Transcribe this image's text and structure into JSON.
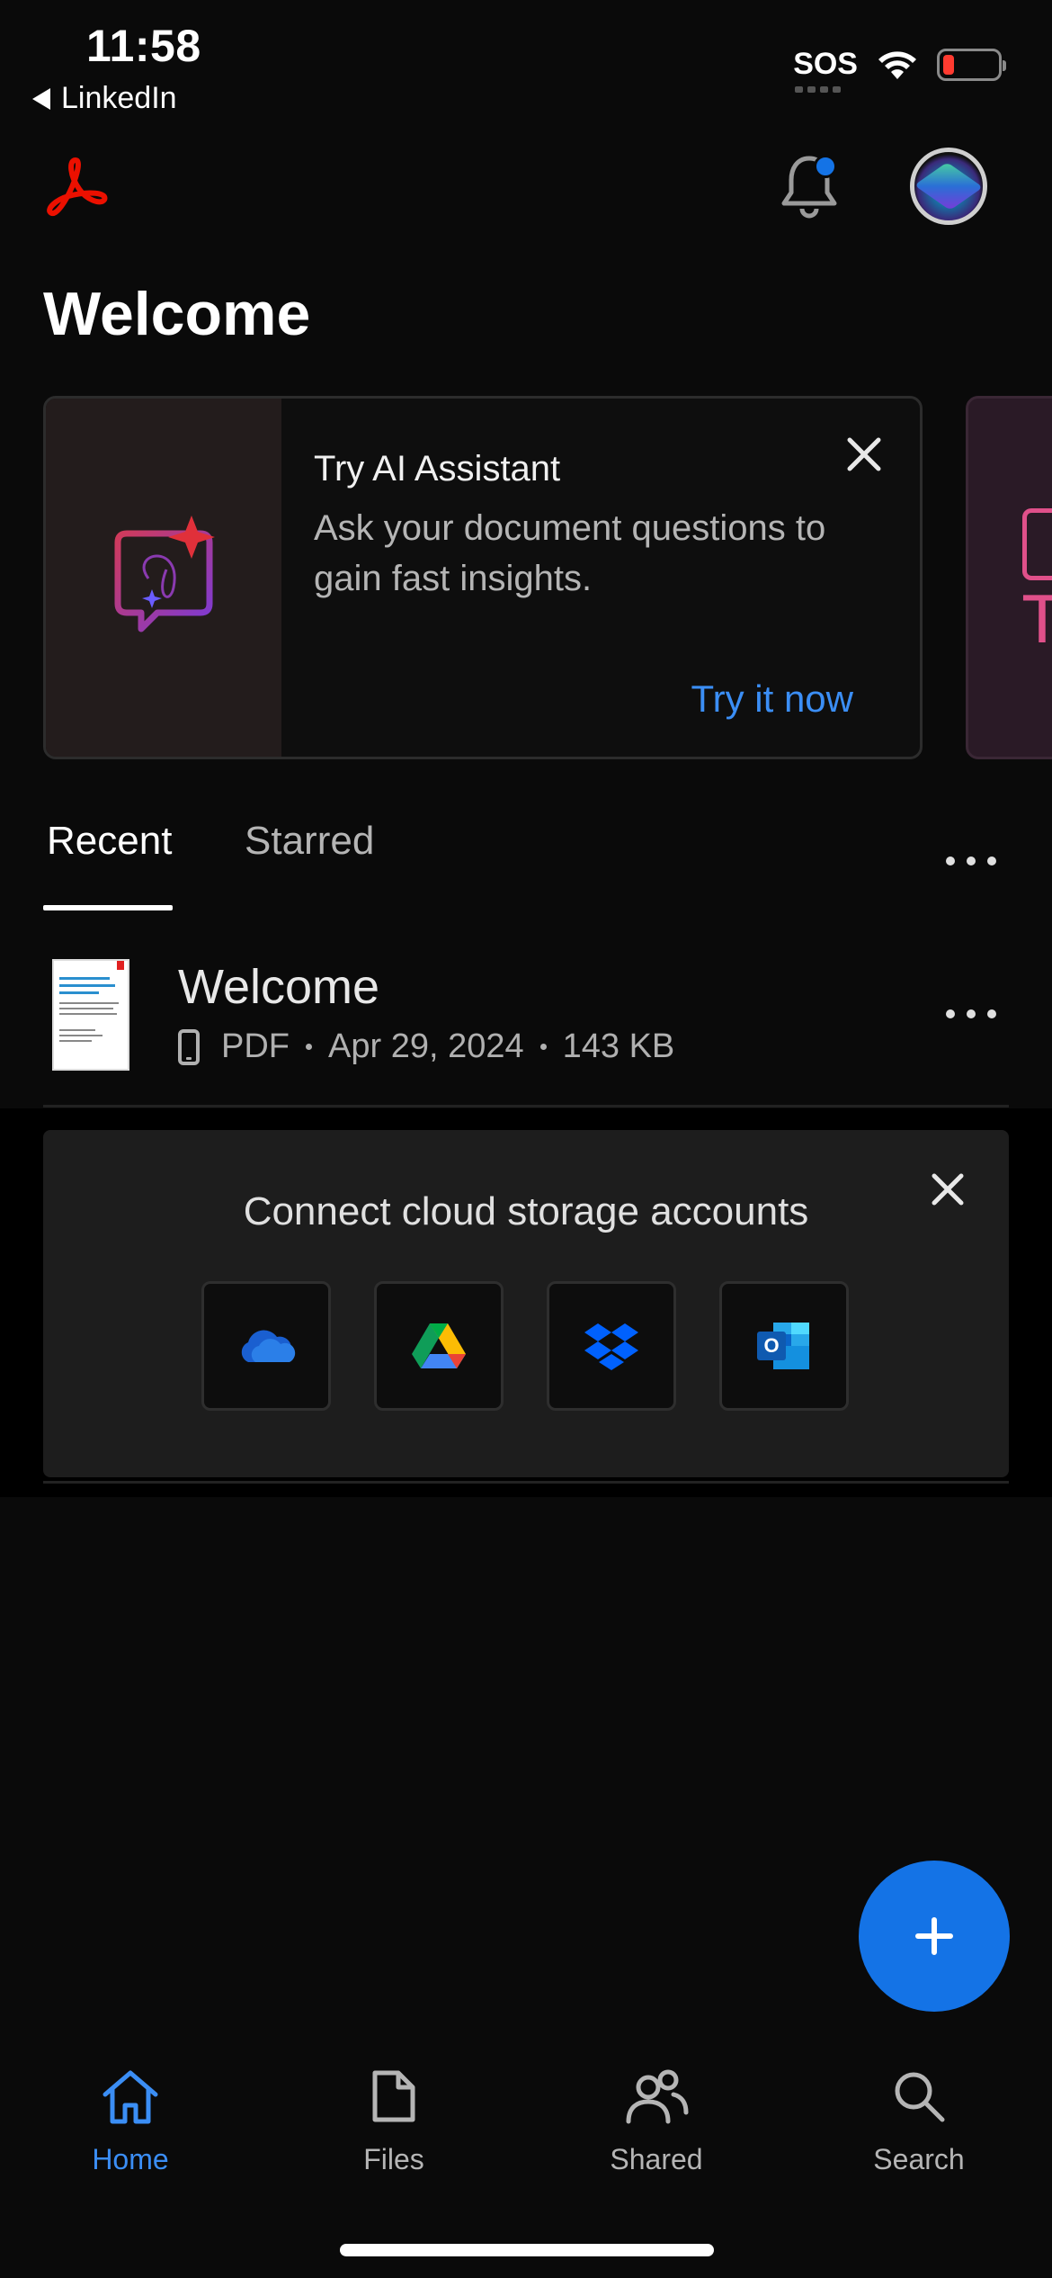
{
  "status_bar": {
    "time": "11:58",
    "back_app": "LinkedIn",
    "carrier": "SOS",
    "battery_level": 0.1
  },
  "header": {
    "title": "Welcome",
    "notification_badge": true
  },
  "promo": {
    "title": "Try AI Assistant",
    "description": "Ask your document questions to gain fast insights.",
    "cta": "Try it now",
    "next_card_letter": "T"
  },
  "tabs": [
    {
      "label": "Recent",
      "active": true
    },
    {
      "label": "Starred",
      "active": false
    }
  ],
  "files": [
    {
      "name": "Welcome",
      "location_icon": "phone-icon",
      "type": "PDF",
      "date": "Apr 29, 2024",
      "size": "143 KB"
    }
  ],
  "cloud": {
    "title": "Connect cloud storage accounts",
    "providers": [
      "onedrive-icon",
      "google-drive-icon",
      "dropbox-icon",
      "outlook-icon"
    ],
    "outlook_letter": "O"
  },
  "bottom_nav": [
    {
      "label": "Home",
      "icon": "home-icon",
      "active": true
    },
    {
      "label": "Files",
      "icon": "file-icon",
      "active": false
    },
    {
      "label": "Shared",
      "icon": "people-icon",
      "active": false
    },
    {
      "label": "Search",
      "icon": "search-icon",
      "active": false
    }
  ],
  "colors": {
    "background": "#0a0a0a",
    "accent": "#1473e6",
    "link": "#3b8ef5",
    "acrobat_red": "#eb1000"
  }
}
